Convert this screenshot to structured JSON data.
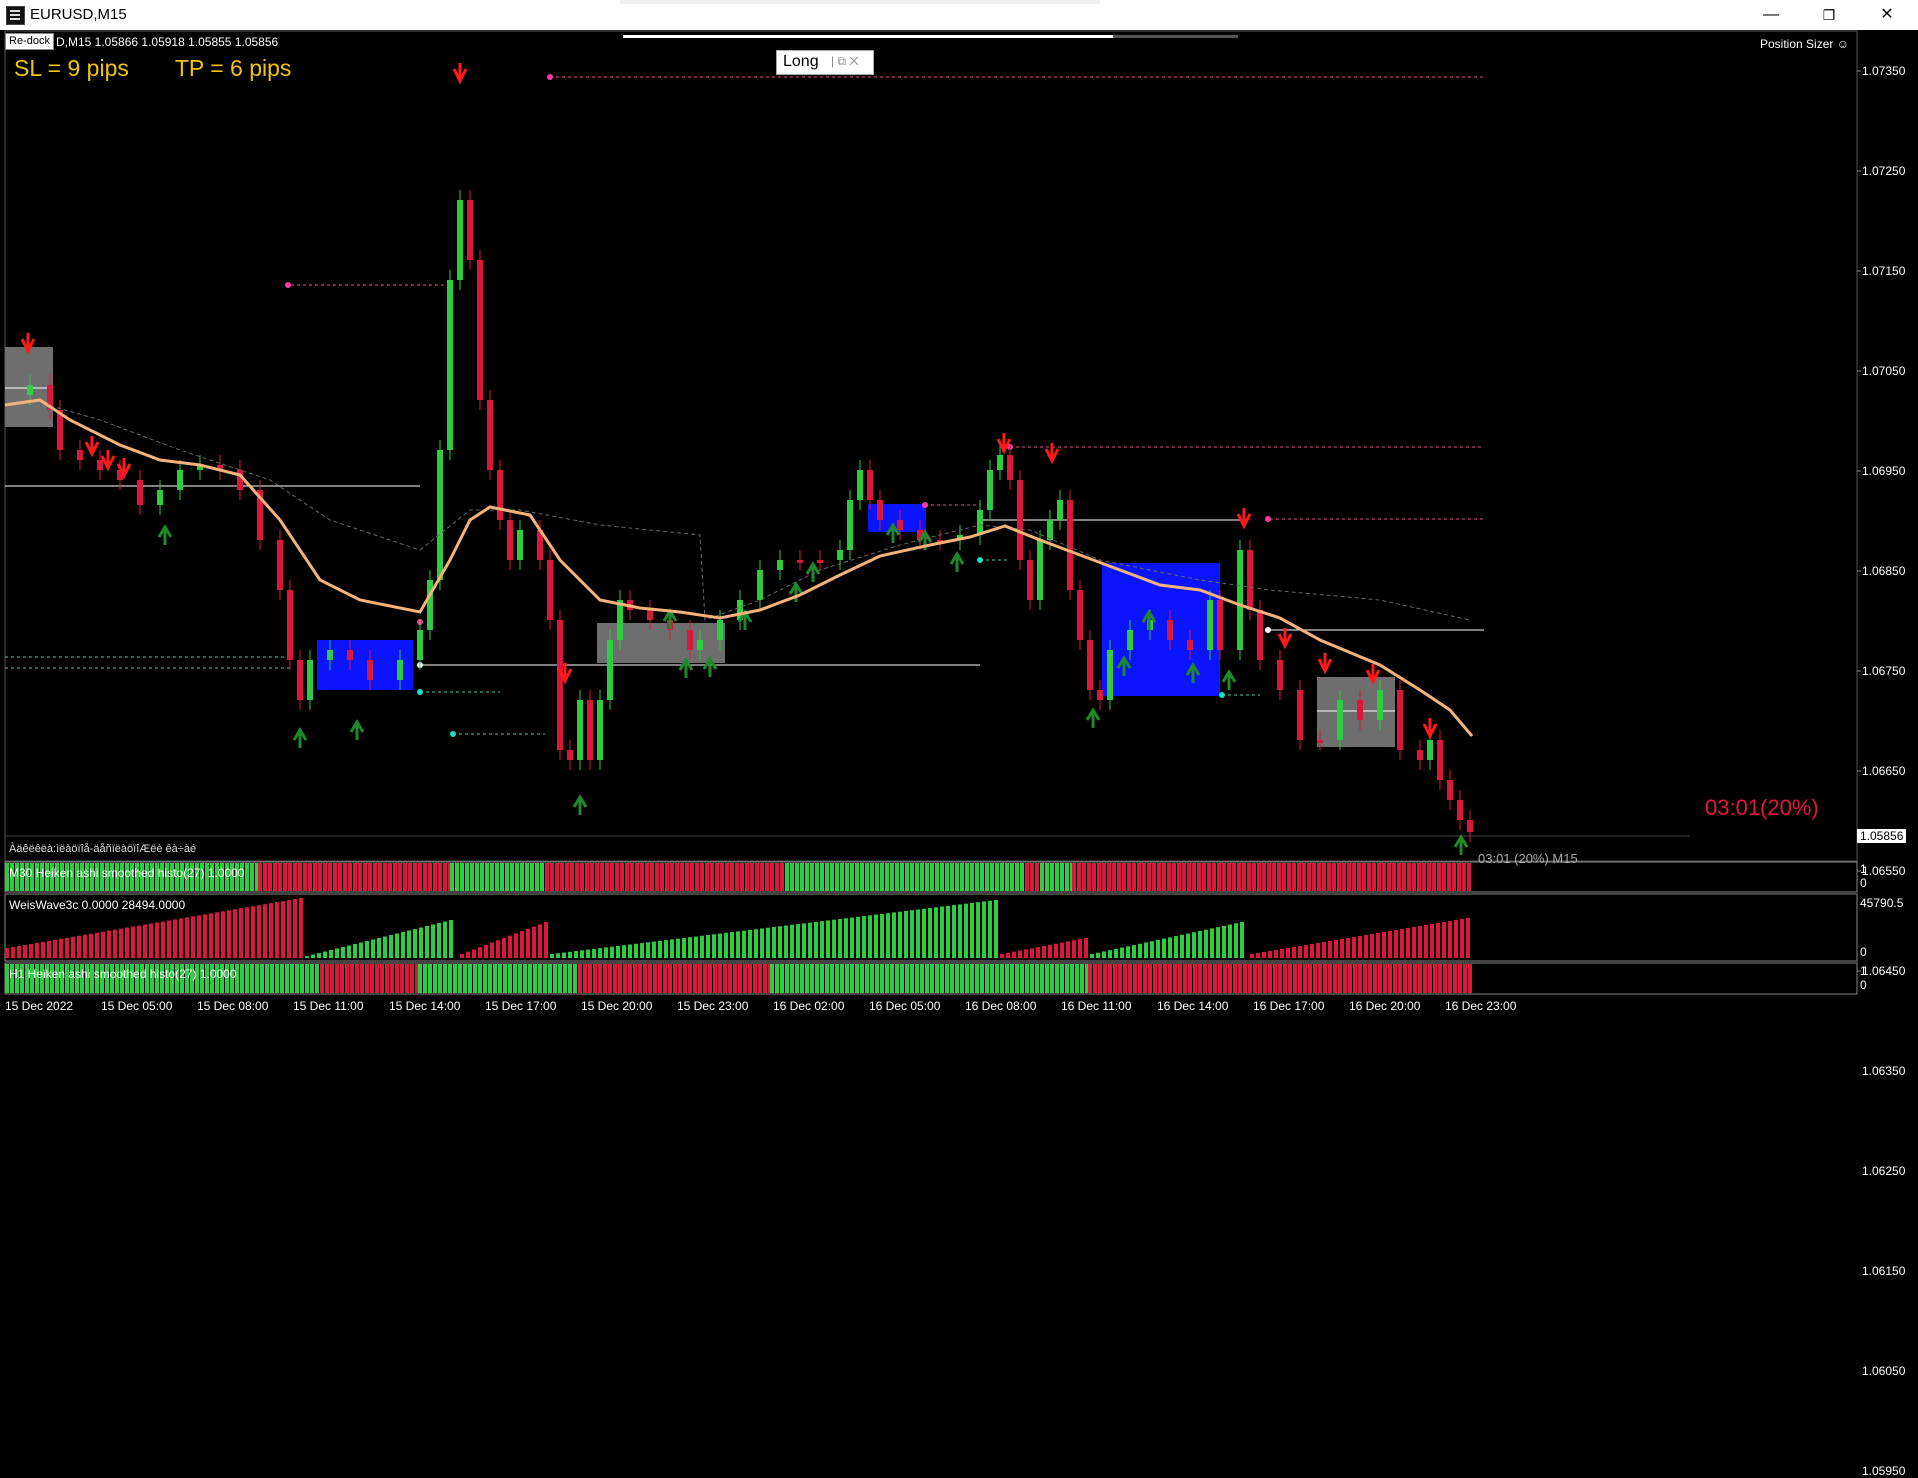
{
  "window": {
    "title": "EURUSD,M15",
    "minimize": "—",
    "restore": "❐",
    "close": "✕"
  },
  "chart": {
    "redock_label": "Re-dock",
    "symbol_info": "D,M15  1.05866 1.05918 1.05855 1.05856",
    "sl_text": "SL = 9 pips",
    "tp_text": "TP = 6 pips",
    "long_panel_label": "Long",
    "long_panel_controls": "| ⧉ ✕",
    "position_sizer_label": "Position Sizer ☺",
    "timer_big": "03:01(20%)",
    "timer_small": "03:01 (20%) M15",
    "current_price": "1.05856",
    "footer_note": "Àäêëêëà:ìëàöïîå-äåñïëàöïîÆëè êà÷àé",
    "y_ticks": [
      "1.07350",
      "1.07250",
      "1.07150",
      "1.07050",
      "1.06950",
      "1.06850",
      "1.06750",
      "1.06650",
      "1.06550",
      "1.06450",
      "1.06350",
      "1.06250",
      "1.06150",
      "1.06050",
      "1.05950"
    ],
    "x_ticks": [
      "15 Dec 2022",
      "15 Dec 05:00",
      "15 Dec 08:00",
      "15 Dec 11:00",
      "15 Dec 14:00",
      "15 Dec 17:00",
      "15 Dec 20:00",
      "15 Dec 23:00",
      "16 Dec 02:00",
      "16 Dec 05:00",
      "16 Dec 08:00",
      "16 Dec 11:00",
      "16 Dec 14:00",
      "16 Dec 17:00",
      "16 Dec 20:00",
      "16 Dec 23:00"
    ]
  },
  "subwindows": {
    "m30_label": "M30 Heiken ashi smoothed histo(27) 1.0000",
    "m30_scale_top": "1",
    "m30_scale_bottom": "0",
    "wei_label": "WeisWave3c 0.0000 28494.0000",
    "wei_scale_top": "45790.5",
    "wei_scale_bottom": "0",
    "h1_label": "H1 Heiken ashi smoothed histo(27) 1.0000",
    "h1_scale_top": "1",
    "h1_scale_bottom": "0"
  },
  "colors": {
    "bull": "#2ecc40",
    "bear": "#d9183b",
    "ma": "#f5b27a",
    "box_blue": "#0a14ff",
    "box_gray": "#6e6e6e",
    "text_yellow": "#f1c40f"
  }
}
